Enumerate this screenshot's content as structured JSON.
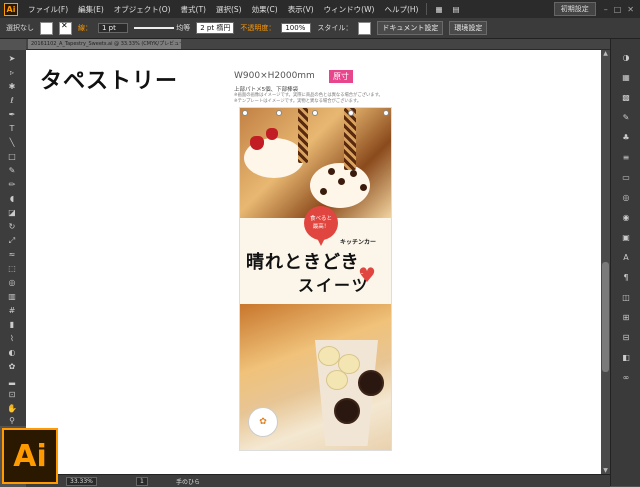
{
  "app": {
    "logo": "Ai"
  },
  "menu": [
    "ファイル(F)",
    "編集(E)",
    "オブジェクト(O)",
    "書式(T)",
    "選択(S)",
    "効果(C)",
    "表示(V)",
    "ウィンドウ(W)",
    "ヘルプ(H)"
  ],
  "workspace": "初期設定",
  "control": {
    "selection": "選択なし",
    "stroke_label": "線：",
    "stroke_weight": "1 pt",
    "profile": "均等",
    "brush": "2 pt 楕円",
    "opacity_label": "不透明度：",
    "opacity": "100%",
    "style_label": "スタイル：",
    "doc_setup": "ドキュメント設定",
    "prefs": "環境設定"
  },
  "document_tab": "20161102_A_Tapestry_Sweets.ai @ 33.33% (CMYK/プレビュー)",
  "artboard": {
    "title": "タペストリー",
    "dimensions": "W900×H2000mm",
    "badge": "原寸",
    "note1": "上部パトメ5個、下部棒袋",
    "note2": "※画面の画像はイメージです。実際に商品の色とは異なる場合がございます。※テンプレートはイメージです。実物と異なる場合がございます。"
  },
  "banner": {
    "bubble_line1": "食べると",
    "bubble_line2": "最高！",
    "kitchen": "キッチンカー",
    "headline": "晴れときどき",
    "subhead": "スイーツ"
  },
  "status": {
    "zoom": "33.33%",
    "artboard_no": "1",
    "tool": "手のひら"
  },
  "colors": {
    "accent": "#ff9a00",
    "badge": "#e8468c",
    "bubble": "#e0463f"
  }
}
